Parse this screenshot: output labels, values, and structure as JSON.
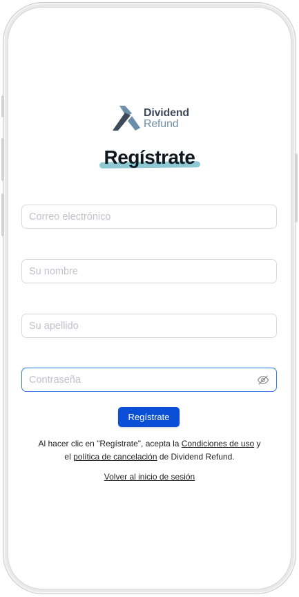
{
  "brand": {
    "line1": "Dividend",
    "line2": "Refund"
  },
  "title": "Regístrate",
  "fields": {
    "email": {
      "placeholder": "Correo electrónico"
    },
    "first_name": {
      "placeholder": "Su nombre"
    },
    "last_name": {
      "placeholder": "Su apellido"
    },
    "password": {
      "placeholder": "Contraseña"
    }
  },
  "submit_label": "Regístrate",
  "terms": {
    "part1": "Al hacer clic en \"Regístrate\", acepta la ",
    "link1": "Condiciones de uso",
    "part2": " y",
    "part3": "el ",
    "link2": "política de cancelación",
    "part4": " de Dividend Refund."
  },
  "back_link": "Volver al inicio de sesión",
  "colors": {
    "primary": "#0a4fd6",
    "highlight": "#8ec9d3",
    "logo_dark": "#3e4a5c",
    "logo_light": "#6b8fa9",
    "focus_border": "#2f7be9"
  },
  "icons": {
    "logo": "dividend-refund-logo-icon",
    "password_toggle": "eye-slash-icon"
  }
}
